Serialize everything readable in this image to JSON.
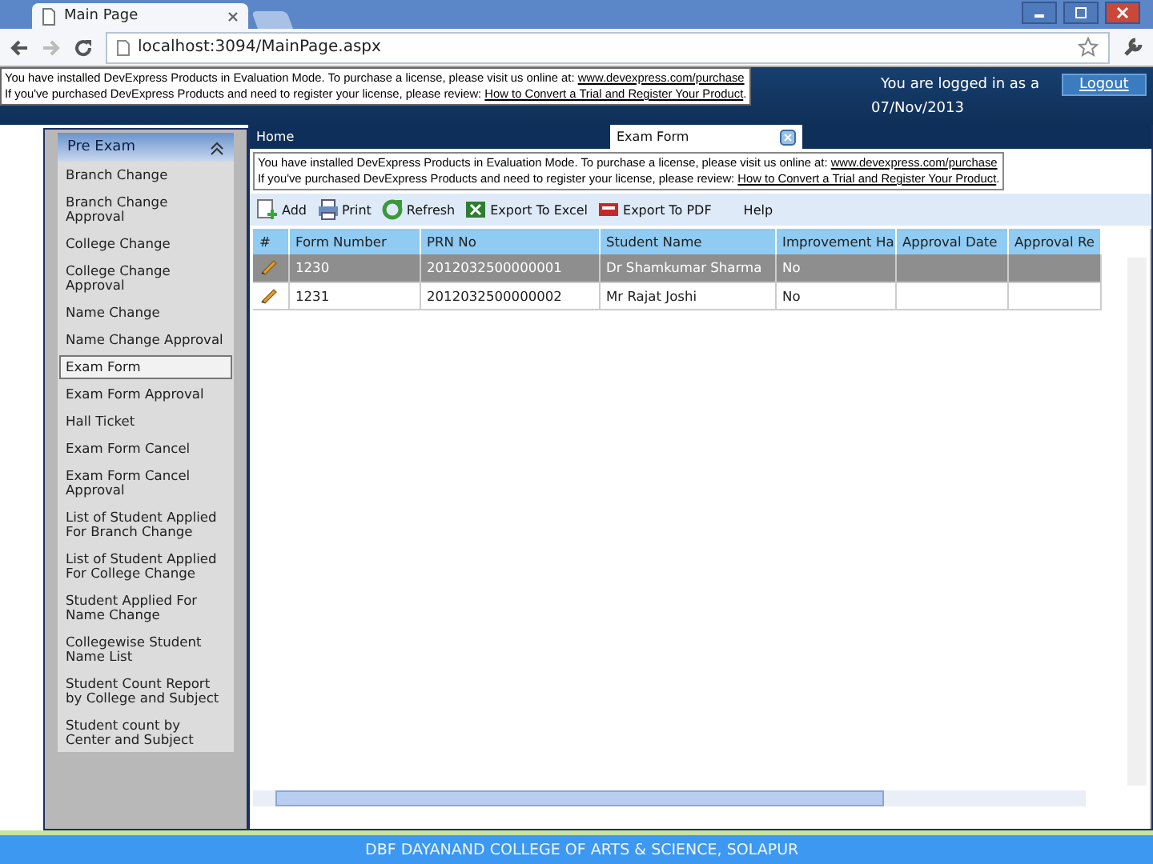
{
  "browser": {
    "tab_title": "Main Page",
    "address": "localhost:3094/MainPage.aspx"
  },
  "header": {
    "login_text": "You are logged in as a",
    "logout": "Logout",
    "date": "07/Nov/2013"
  },
  "eval_notice": {
    "line1": "You have installed DevExpress Products in Evaluation Mode. To purchase a license, please visit us online at: ",
    "link1": "www.devexpress.com/purchase",
    "line2": "If you've purchased DevExpress Products and need to register your license, please review: ",
    "link2": "How to Convert a Trial and Register Your Product",
    "end": "."
  },
  "sidebar": {
    "group": "Pre Exam",
    "expanded": true,
    "items": [
      {
        "label": "Branch Change",
        "selected": false
      },
      {
        "label": "Branch Change Approval",
        "selected": false
      },
      {
        "label": "College Change",
        "selected": false
      },
      {
        "label": "College Change Approval",
        "selected": false
      },
      {
        "label": "Name Change",
        "selected": false
      },
      {
        "label": "Name Change Approval",
        "selected": false
      },
      {
        "label": "Exam Form",
        "selected": true
      },
      {
        "label": "Exam Form Approval",
        "selected": false
      },
      {
        "label": "Hall Ticket",
        "selected": false
      },
      {
        "label": "Exam Form Cancel",
        "selected": false
      },
      {
        "label": "Exam Form Cancel Approval",
        "selected": false
      },
      {
        "label": "List of Student Applied For Branch Change",
        "selected": false
      },
      {
        "label": "List of Student Applied For College Change",
        "selected": false
      },
      {
        "label": "Student Applied For Name Change",
        "selected": false
      },
      {
        "label": "Collegewise Student Name List",
        "selected": false
      },
      {
        "label": "Student Count Report by College and Subject",
        "selected": false
      },
      {
        "label": "Student count by Center and Subject",
        "selected": false
      }
    ]
  },
  "tabs": [
    {
      "label": "Home",
      "selected": false
    },
    {
      "label": "Exam Form",
      "selected": true
    }
  ],
  "inner_notice": {
    "line1": "You have installed DevExpress Products in Evaluation Mode. To purchase a license, please visit us online at: ",
    "link1": "www.devexpress.com/purchase",
    "line2": "If you've purchased DevExpress Products and need to register your license, please review: ",
    "link2": "How to Convert a Trial and Register Your Product",
    "end": "."
  },
  "toolbar": [
    {
      "kind": "add",
      "label": "Add"
    },
    {
      "kind": "print",
      "label": "Print"
    },
    {
      "kind": "refresh",
      "label": "Refresh"
    },
    {
      "kind": "excel",
      "label": "Export To Excel"
    },
    {
      "kind": "pdf",
      "label": "Export To PDF"
    },
    {
      "kind": "help",
      "label": "Help"
    }
  ],
  "table": {
    "columns": [
      "#",
      "Form Number",
      "PRN No",
      "Student Name",
      "Improvement Ha",
      "Approval Date",
      "Approval Re"
    ],
    "rows": [
      {
        "selected": true,
        "cells": [
          "",
          "1230",
          "2012032500000001",
          "Dr Shamkumar Sharma",
          "No",
          "",
          ""
        ]
      },
      {
        "selected": false,
        "cells": [
          "",
          "1231",
          "2012032500000002",
          "Mr Rajat Joshi",
          "No",
          "",
          ""
        ]
      }
    ]
  },
  "footer": "DBF DAYANAND COLLEGE OF ARTS & SCIENCE, SOLAPUR"
}
